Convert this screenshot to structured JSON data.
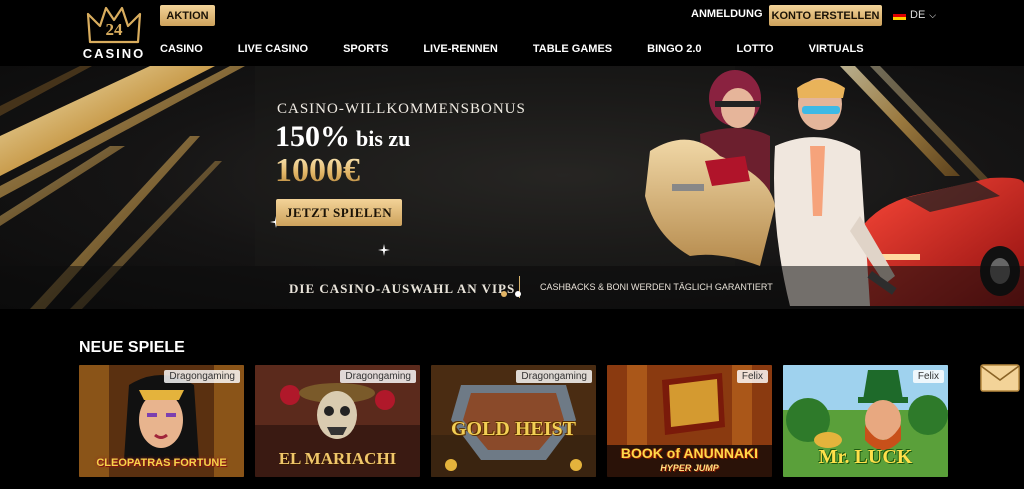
{
  "logo": {
    "number": "24",
    "word": "CASINO",
    "icon": "crown-logo-icon"
  },
  "header": {
    "aktion_label": "AKTION",
    "login_label": "ANMELDUNG",
    "register_label": "KONTO ERSTELLEN",
    "language": {
      "code": "DE",
      "icon": "german-flag-icon",
      "caret": "chevron-down-icon"
    }
  },
  "nav": {
    "items": [
      "CASINO",
      "LIVE CASINO",
      "SPORTS",
      "LIVE-RENNEN",
      "TABLE GAMES",
      "BINGO 2.0",
      "LOTTO",
      "VIRTUALS"
    ]
  },
  "hero": {
    "subtitle": "CASINO-WILLKOMMENSBONUS",
    "line1_main": "150%",
    "line1_small": "bis zu",
    "line2": "1000€",
    "cta_label": "JETZT SPIELEN",
    "bar_left": "DIE CASINO-AUSWAHL AN VIPS",
    "bar_right": "CASHBACKS & BONI WERDEN TÄGLICH GARANTIERT"
  },
  "games_section": {
    "title": "NEUE SPIELE",
    "games": [
      {
        "title": "CLEOPATRAS FORTUNE",
        "provider": "Dragongaming"
      },
      {
        "title": "EL MARIACHI",
        "provider": "Dragongaming"
      },
      {
        "title": "GOLD HEIST",
        "provider": "Dragongaming"
      },
      {
        "title": "BOOK of ANUNNAKI",
        "subtitle": "HYPER JUMP",
        "provider": "Felix"
      },
      {
        "title": "Mr. LUCK",
        "provider": "Felix"
      }
    ]
  },
  "colors": {
    "gold": "#d9ad5e",
    "gold_light": "#f3d398",
    "background": "#000000"
  },
  "contact": {
    "icon": "envelope-icon"
  }
}
